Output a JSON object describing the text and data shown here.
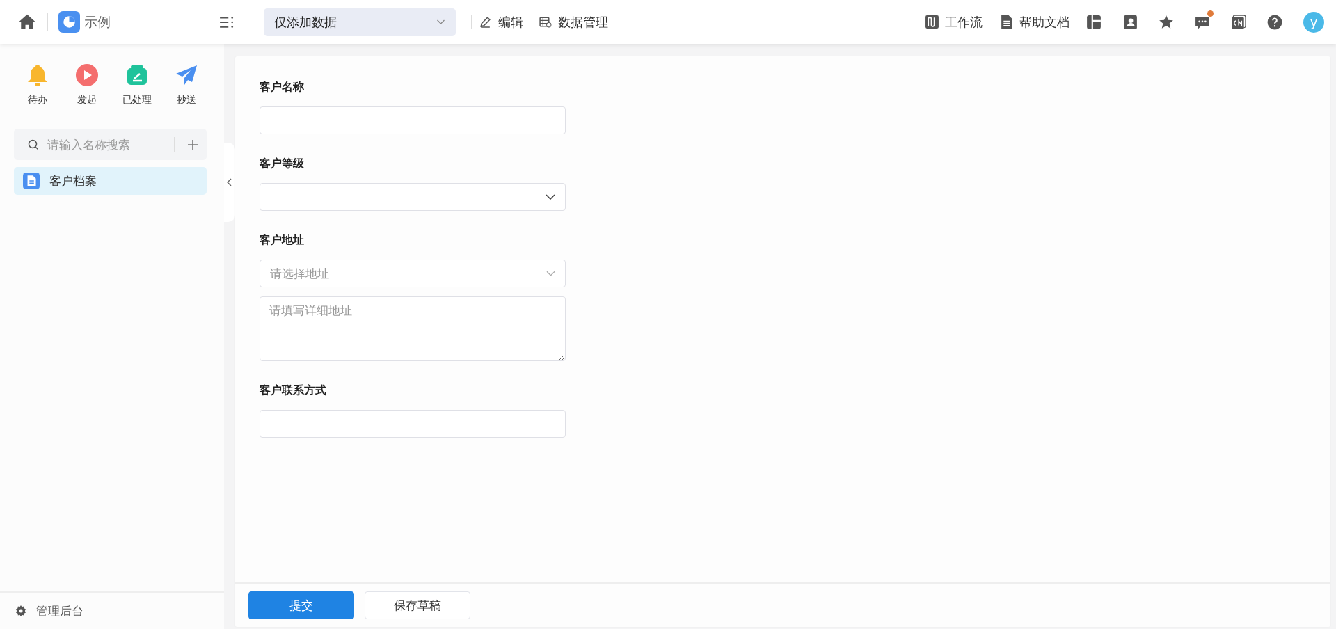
{
  "header": {
    "app_name": "示例",
    "view_select": {
      "value": "仅添加数据"
    },
    "actions": [
      {
        "kind": "edit",
        "label": "编辑"
      },
      {
        "kind": "data",
        "label": "数据管理"
      }
    ],
    "links": [
      {
        "kind": "workflow",
        "label": "工作流"
      },
      {
        "kind": "doc",
        "label": "帮助文档"
      }
    ],
    "icons": [
      {
        "kind": "layout",
        "unread": false
      },
      {
        "kind": "contacts",
        "unread": false
      },
      {
        "kind": "star",
        "unread": false
      },
      {
        "kind": "message",
        "unread": true
      },
      {
        "kind": "lang",
        "unread": false
      },
      {
        "kind": "help",
        "unread": false
      }
    ],
    "avatar": "y"
  },
  "sidebar": {
    "quick": [
      {
        "kind": "bell",
        "label": "待办"
      },
      {
        "kind": "play",
        "label": "发起"
      },
      {
        "kind": "tray",
        "label": "已处理"
      },
      {
        "kind": "plane",
        "label": "抄送"
      }
    ],
    "search": {
      "placeholder": "请输入名称搜索"
    },
    "items": [
      {
        "label": "客户档案",
        "selected": true
      }
    ],
    "footer": "管理后台"
  },
  "form": {
    "fields": [
      {
        "kind": "input",
        "label": "客户名称"
      },
      {
        "kind": "select",
        "label": "客户等级"
      },
      {
        "kind": "address",
        "label": "客户地址",
        "select_placeholder": "请选择地址",
        "detail_placeholder": "请填写详细地址"
      },
      {
        "kind": "input",
        "label": "客户联系方式"
      }
    ],
    "buttons": [
      {
        "kind": "primary",
        "label": "提交"
      },
      {
        "kind": "default",
        "label": "保存草稿"
      }
    ]
  }
}
